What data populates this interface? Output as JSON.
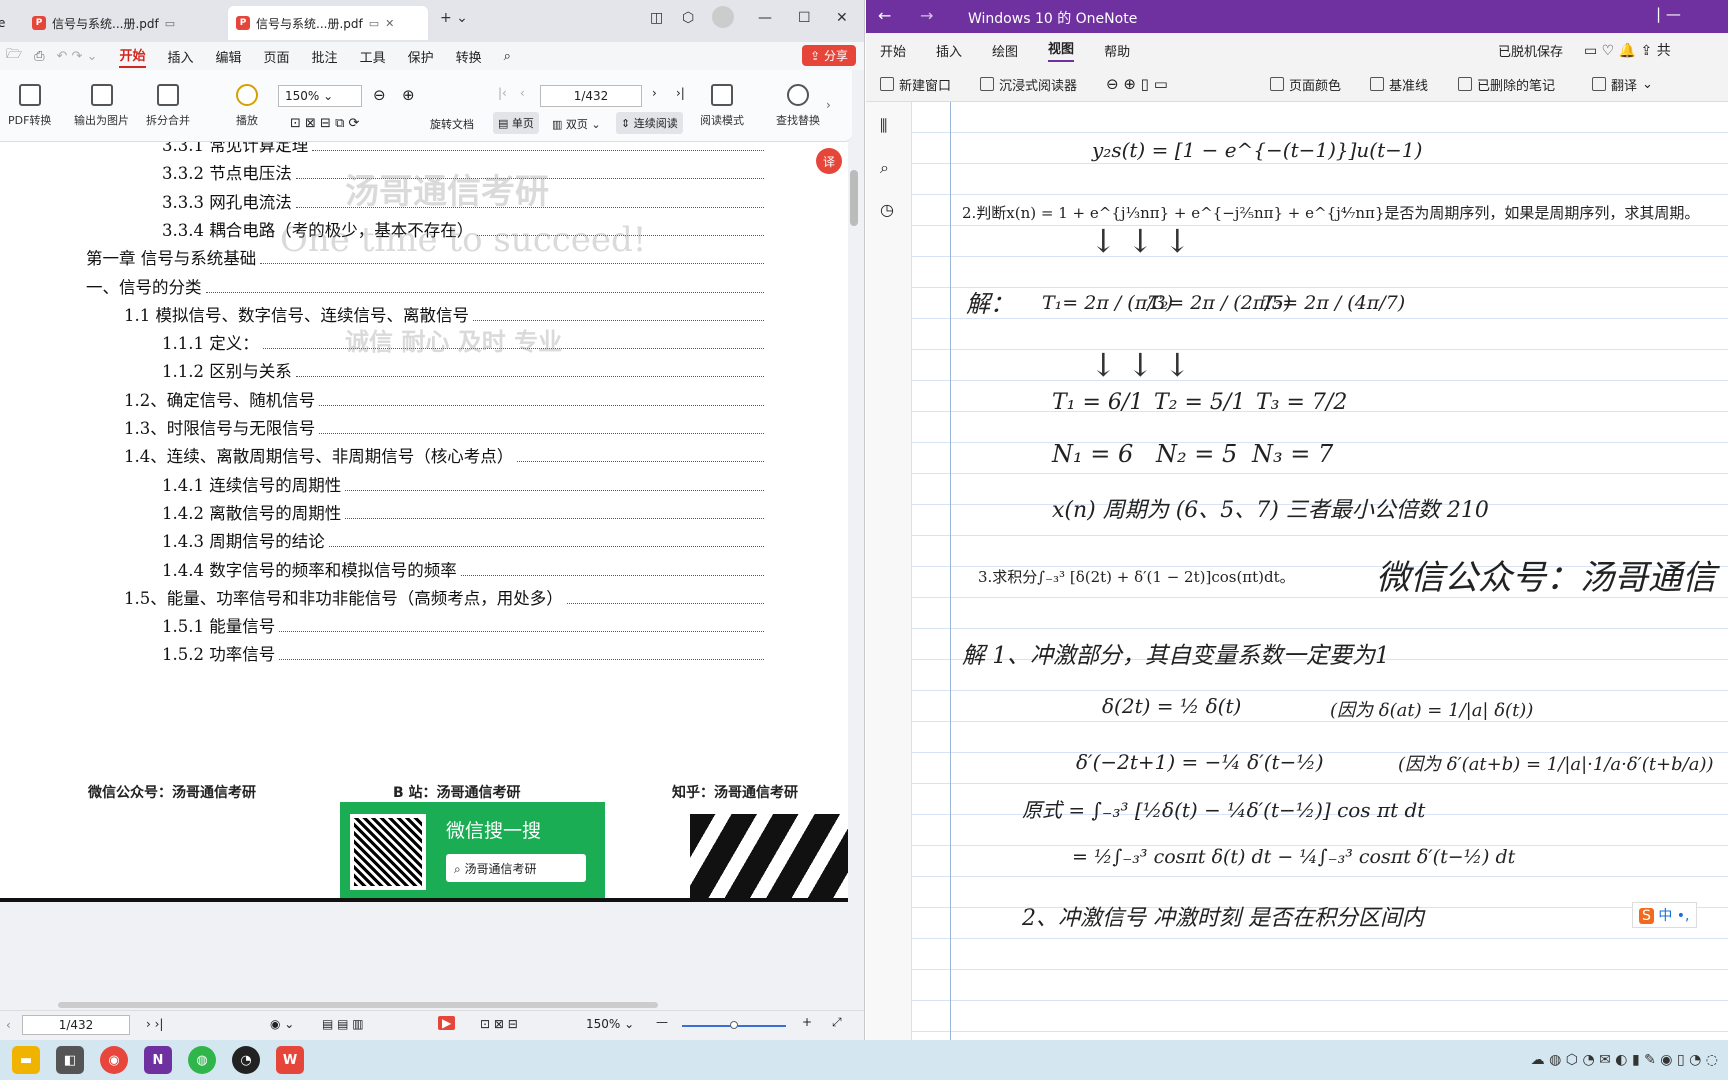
{
  "pdf": {
    "tabs": [
      {
        "label": "信号与系统...册.pdf"
      },
      {
        "label": "信号与系统...册.pdf"
      }
    ],
    "menu": [
      "开始",
      "插入",
      "编辑",
      "页面",
      "批注",
      "工具",
      "保护",
      "转换"
    ],
    "share_label": "分享",
    "ribbon": {
      "pdf_convert": "PDF转换",
      "export_image": "输出为图片",
      "split_merge": "拆分合并",
      "play": "播放",
      "zoom": "150%",
      "page": "1/432",
      "rotate": "旋转文档",
      "single": "单页",
      "double": "双页",
      "continuous": "连续阅读",
      "read_mode": "阅读模式",
      "find_replace": "查找替换"
    },
    "toc": [
      {
        "t": "3.3.1 常见计算定理",
        "l": 1
      },
      {
        "t": "3.3.2 节点电压法",
        "l": 1
      },
      {
        "t": "3.3.3 网孔电流法",
        "l": 1
      },
      {
        "t": "3.3.4 耦合电路（考的极少，基本不存在）",
        "l": 1
      },
      {
        "t": "第一章 信号与系统基础",
        "l": 3
      },
      {
        "t": "一、信号的分类",
        "l": 3
      },
      {
        "t": "1.1 模拟信号、数字信号、连续信号、离散信号",
        "l": 2
      },
      {
        "t": "1.1.1 定义：",
        "l": 1
      },
      {
        "t": "1.1.2 区别与关系",
        "l": 1
      },
      {
        "t": "1.2、确定信号、随机信号",
        "l": 2
      },
      {
        "t": "1.3、时限信号与无限信号",
        "l": 2
      },
      {
        "t": "1.4、连续、离散周期信号、非周期信号（核心考点）",
        "l": 2
      },
      {
        "t": "1.4.1 连续信号的周期性",
        "l": 1
      },
      {
        "t": "1.4.2 离散信号的周期性",
        "l": 1
      },
      {
        "t": "1.4.3 周期信号的结论",
        "l": 1
      },
      {
        "t": "1.4.4 数字信号的频率和模拟信号的频率",
        "l": 1
      },
      {
        "t": "1.5、能量、功率信号和非功非能信号（高频考点，用处多）",
        "l": 2
      },
      {
        "t": "1.5.1 能量信号",
        "l": 1
      },
      {
        "t": "1.5.2 功率信号",
        "l": 1
      }
    ],
    "watermarks": {
      "w1": "汤哥通信考研",
      "w2": "One time to succeed!",
      "w3": "诚信 耐心 及时 专业"
    },
    "footer": {
      "wechat": "微信公众号：汤哥通信考研",
      "bilibili": "B 站：汤哥通信考研",
      "zhihu": "知乎：汤哥通信考研",
      "search_title": "微信搜一搜",
      "search_text": "汤哥通信考研"
    },
    "bottom": {
      "page": "1/432",
      "zoom": "150%"
    }
  },
  "onenote": {
    "title": "Windows 10 的 OneNote",
    "menu": [
      "开始",
      "插入",
      "绘图",
      "视图",
      "帮助"
    ],
    "right": {
      "offline": "已脱机保存",
      "share": "共"
    },
    "tools": {
      "new_window": "新建窗口",
      "immersive": "沉浸式阅读器",
      "page_color": "页面颜色",
      "rule_lines": "基准线",
      "deleted": "已删除的笔记",
      "translate": "翻译"
    },
    "content": {
      "l1": "y₂s(t) = [1 − e^{−(t−1)}]u(t−1)",
      "q2": "2.判断x(n) = 1 + e^{j⅓nπ} + e^{−j⅖nπ} + e^{j⁴⁄₇nπ}是否为周期序列，如果是周期序列，求其周期。",
      "sol": "解：",
      "t_frac": [
        "T₁= 2π / (π/3)",
        "T₂= 2π / (2π/5)",
        "T₃= 2π / (4π/7)"
      ],
      "t_vals": [
        "T₁ = 6/1",
        "T₂ = 5/1",
        "T₃ = 7/2"
      ],
      "n_vals": [
        "N₁ = 6",
        "N₂ = 5",
        "N₃ = 7"
      ],
      "period": "x(n) 周期为 (6、5、7) 三者最小公倍数 210",
      "q3": "3.求积分∫₋₃³ [δ(2t) + δ′(1 − 2t)]cos(πt)dt。",
      "wm": "微信公众号：汤哥通信",
      "s1": "解  1、冲激部分，其自变量系数一定要为1",
      "e1": "δ(2t) = ½ δ(t)",
      "e1b": "(因为 δ(at) = 1/|a| δ(t))",
      "e2": "δ′(−2t+1) = −¼ δ′(t−½)",
      "e2b": "(因为 δ′(at+b) = 1/|a|·1/a·δ′(t+b/a))",
      "e3": "原式 = ∫₋₃³ [½δ(t) − ¼δ′(t−½)] cos πt dt",
      "e4": "= ½∫₋₃³ cosπt δ(t) dt  − ¼∫₋₃³ cosπt δ′(t−½) dt",
      "s2": "2、冲激信号 冲激时刻 是否在积分区间内"
    },
    "ime": "中"
  }
}
